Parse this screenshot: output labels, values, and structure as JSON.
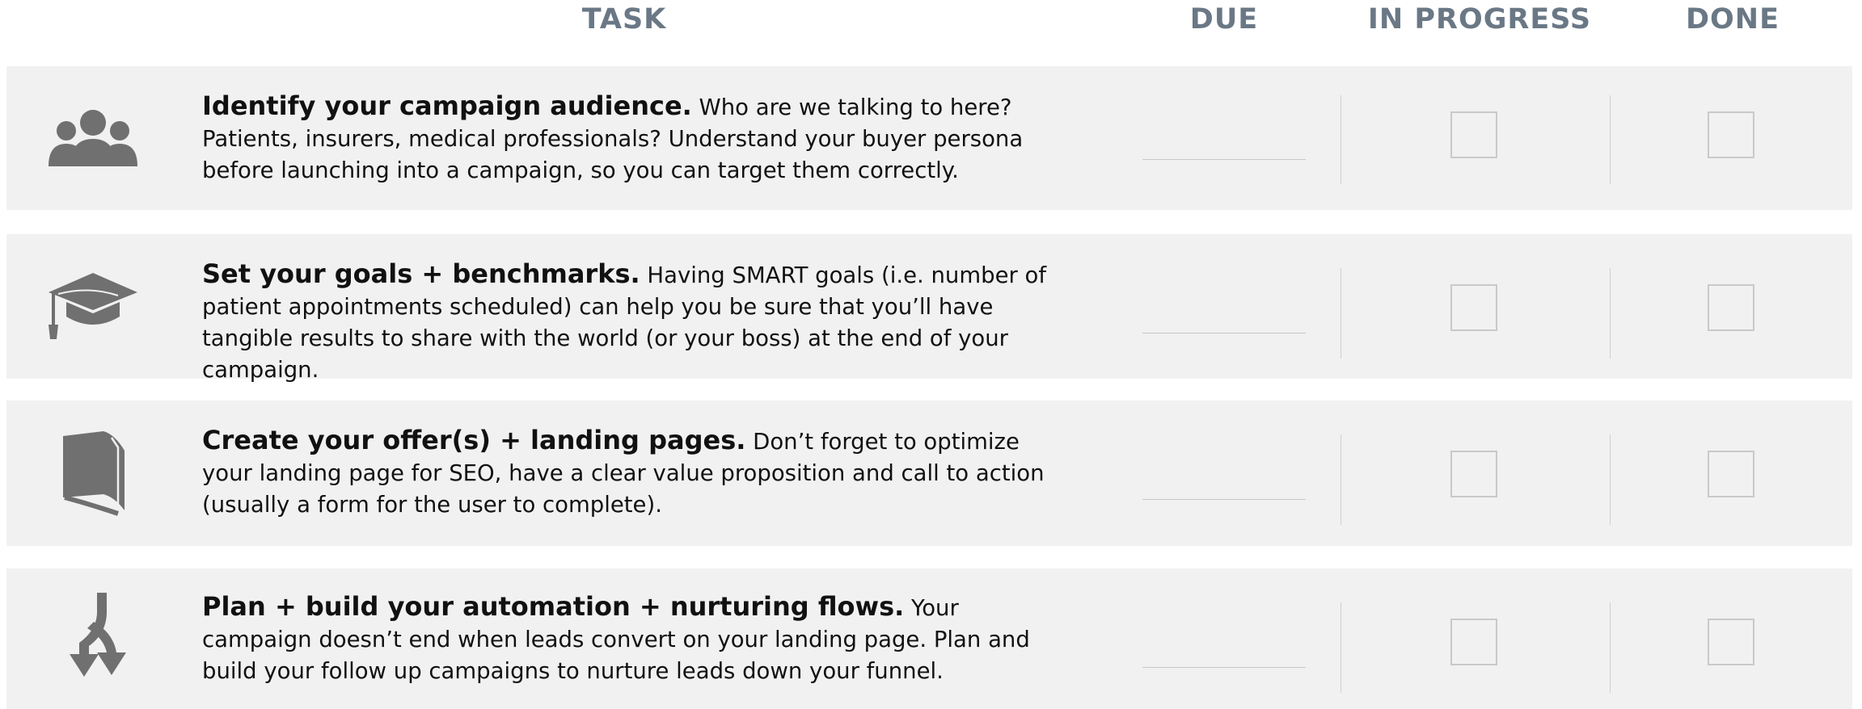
{
  "header": {
    "task": "TASK",
    "due": "DUE",
    "in_progress": "IN PROGRESS",
    "done": "DONE"
  },
  "colors": {
    "header_text": "#6a7886",
    "row_background": "#f1f1f1",
    "icon": "#707070",
    "checkbox_border": "#c9c9c9"
  },
  "tasks": [
    {
      "icon": "people-group-icon",
      "title": "Identify your campaign audience.",
      "body": "Who are we talking to here? Patients, insurers, medical professionals? Understand your buyer persona before launching into a campaign, so you can target them correctly.",
      "due": "",
      "in_progress": false,
      "done": false
    },
    {
      "icon": "graduation-cap-icon",
      "title": "Set your goals + benchmarks.",
      "body": "Having SMART goals (i.e. number of patient appointments scheduled) can help you be sure that you’ll have tangible results to share with the world (or your boss) at the end of your campaign.",
      "due": "",
      "in_progress": false,
      "done": false
    },
    {
      "icon": "book-icon",
      "title": "Create your offer(s) + landing pages.",
      "body": "Don’t forget to optimize your landing page for SEO, have a clear value proposition and call to action (usually a form for the user to complete).",
      "due": "",
      "in_progress": false,
      "done": false
    },
    {
      "icon": "split-arrows-icon",
      "title": "Plan + build your automation + nurturing flows.",
      "body": "Your campaign doesn’t end when leads convert on your landing page. Plan and build your follow up campaigns to nurture leads down your funnel.",
      "due": "",
      "in_progress": false,
      "done": false
    }
  ]
}
